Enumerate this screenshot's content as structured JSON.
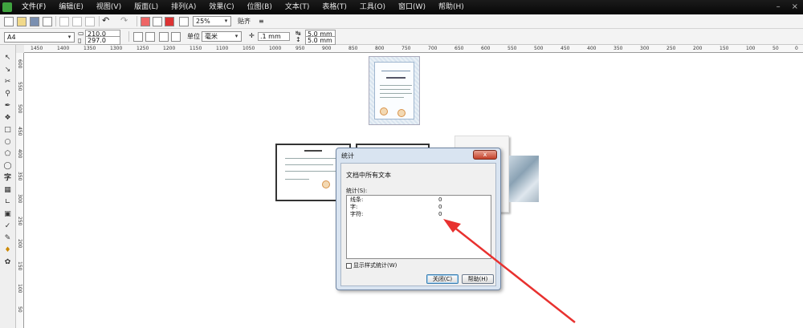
{
  "titlebar": {
    "menu": [
      "文件(F)",
      "编辑(E)",
      "视图(V)",
      "版面(L)",
      "排列(A)",
      "效果(C)",
      "位图(B)",
      "文本(T)",
      "表格(T)",
      "工具(O)",
      "窗口(W)",
      "帮助(H)"
    ]
  },
  "toolbar1": {
    "zoom": "25%",
    "snap": "贴齐"
  },
  "toolbar2": {
    "page_size": "A4",
    "width": "210.0 mm",
    "height": "297.0 mm",
    "unit_label": "单位",
    "unit": "毫米",
    "nudge": ".1 mm",
    "dup_x": "5.0 mm",
    "dup_y": "5.0 mm"
  },
  "ruler": {
    "h_labels": [
      "1450",
      "1400",
      "1350",
      "1300",
      "1250",
      "1200",
      "1150",
      "1100",
      "1050",
      "1000",
      "950",
      "900",
      "850",
      "800",
      "750",
      "700",
      "650",
      "600",
      "550",
      "500",
      "450",
      "400",
      "350",
      "300",
      "250",
      "200",
      "150",
      "100",
      "50",
      "0"
    ],
    "v_labels": [
      "600",
      "550",
      "500",
      "450",
      "400",
      "350",
      "300",
      "250",
      "200",
      "150",
      "100",
      "50"
    ]
  },
  "dialog": {
    "title": "统计",
    "close_glyph": "x",
    "heading": "文档中所有文本",
    "stats_label": "统计(S):",
    "stats": [
      {
        "label": "线条:",
        "value": "0"
      },
      {
        "label": "字:",
        "value": "0"
      },
      {
        "label": "字符:",
        "value": "0"
      }
    ],
    "show_styles_label": "显示样式统计(W)",
    "close_button": "关闭(C)",
    "help_button": "帮助(H)"
  },
  "colors": {
    "annotation_arrow": "#e8312f",
    "dialog_frame": "#d9e4f1"
  }
}
